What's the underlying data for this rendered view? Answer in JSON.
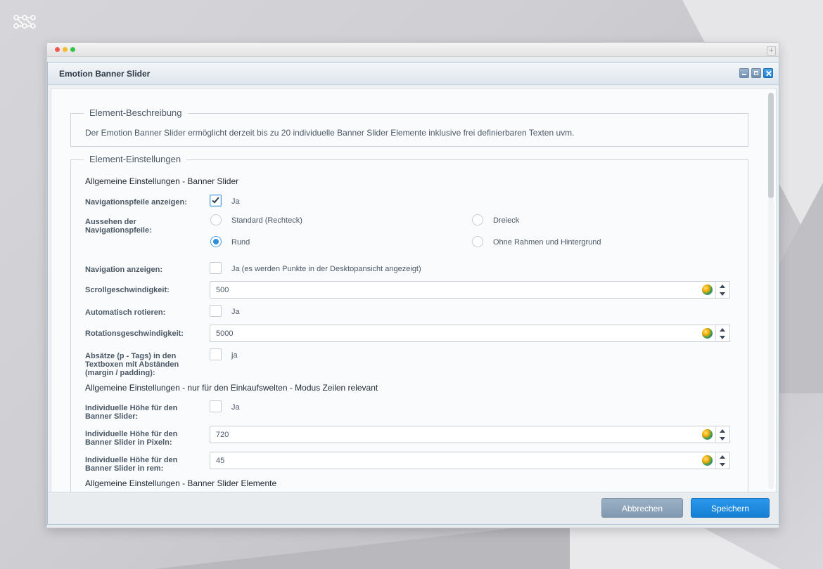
{
  "window": {
    "title": "Emotion Banner Slider",
    "outer_plus": "+"
  },
  "description_section": {
    "legend": "Element-Beschreibung",
    "text": "Der Emotion Banner Slider ermöglicht derzeit bis zu 20 individuelle Banner Slider Elemente inklusive frei definierbaren Texten uvm."
  },
  "settings_section": {
    "legend": "Element-Einstellungen",
    "general_title": "Allgemeine Einstellungen - Banner Slider",
    "nav_arrows": {
      "label": "Navigationspfeile anzeigen:",
      "checked": true,
      "text": "Ja"
    },
    "arrow_style": {
      "label": "Aussehen der Navigationspfeile:",
      "options": [
        {
          "label": "Standard (Rechteck)",
          "selected": false
        },
        {
          "label": "Dreieck",
          "selected": false
        },
        {
          "label": "Rund",
          "selected": true
        },
        {
          "label": "Ohne Rahmen und Hintergrund",
          "selected": false
        }
      ]
    },
    "show_nav": {
      "label": "Navigation anzeigen:",
      "checked": false,
      "text": "Ja (es werden Punkte in der Desktopansicht angezeigt)"
    },
    "scroll_speed": {
      "label": "Scrollgeschwindigkeit:",
      "value": "500"
    },
    "auto_rotate": {
      "label": "Automatisch rotieren:",
      "checked": false,
      "text": "Ja"
    },
    "rotation_speed": {
      "label": "Rotationsgeschwindigkeit:",
      "value": "5000"
    },
    "paragraphs": {
      "label": "Absätze (p - Tags) in den Textboxen mit Abständen (margin / padding):",
      "checked": false,
      "text": "ja"
    },
    "rows_title": "Allgemeine Einstellungen - nur für den Einkaufswelten - Modus Zeilen relevant",
    "custom_height": {
      "label": "Individuelle Höhe für den Banner Slider:",
      "checked": false,
      "text": "Ja"
    },
    "height_px": {
      "label": "Individuelle Höhe für den Banner Slider in Pixeln:",
      "value": "720"
    },
    "height_rem": {
      "label": "Individuelle Höhe für den Banner Slider in rem:",
      "value": "45"
    },
    "elements_title": "Allgemeine Einstellungen - Banner Slider Elemente"
  },
  "footer": {
    "cancel_label": "Abbrechen",
    "save_label": "Speichern"
  },
  "colors": {
    "accent": "#1f8ae0",
    "cancel": "#8ea3b8"
  }
}
